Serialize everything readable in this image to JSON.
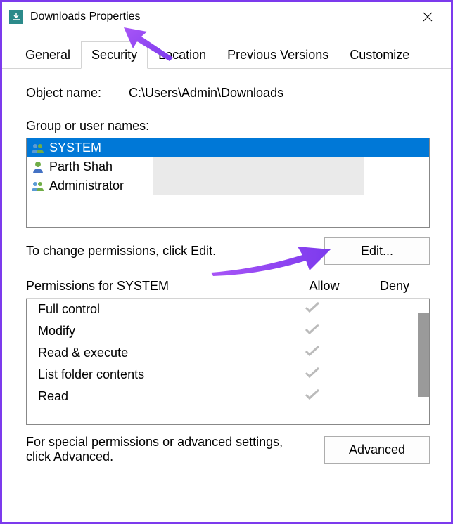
{
  "window": {
    "title": "Downloads Properties"
  },
  "tabs": {
    "items": [
      {
        "label": "General"
      },
      {
        "label": "Security"
      },
      {
        "label": "Location"
      },
      {
        "label": "Previous Versions"
      },
      {
        "label": "Customize"
      }
    ],
    "active_index": 1
  },
  "object": {
    "label": "Object name:",
    "value": "C:\\Users\\Admin\\Downloads"
  },
  "group": {
    "label": "Group or user names:",
    "items": [
      {
        "name": "SYSTEM",
        "icon": "group",
        "selected": true
      },
      {
        "name": "Parth Shah",
        "icon": "user",
        "selected": false
      },
      {
        "name": "Administrators",
        "icon": "group",
        "selected": false,
        "truncated": "Administrator"
      }
    ]
  },
  "edit": {
    "text": "To change permissions, click Edit.",
    "button": "Edit..."
  },
  "permissions": {
    "header": "Permissions for SYSTEM",
    "allow_label": "Allow",
    "deny_label": "Deny",
    "items": [
      {
        "name": "Full control",
        "allow": true,
        "deny": false
      },
      {
        "name": "Modify",
        "allow": true,
        "deny": false
      },
      {
        "name": "Read & execute",
        "allow": true,
        "deny": false
      },
      {
        "name": "List folder contents",
        "allow": true,
        "deny": false
      },
      {
        "name": "Read",
        "allow": true,
        "deny": false
      }
    ]
  },
  "advanced": {
    "text": "For special permissions or advanced settings, click Advanced.",
    "button": "Advanced"
  },
  "annotations": {
    "arrow_color": "#8b3dff"
  }
}
